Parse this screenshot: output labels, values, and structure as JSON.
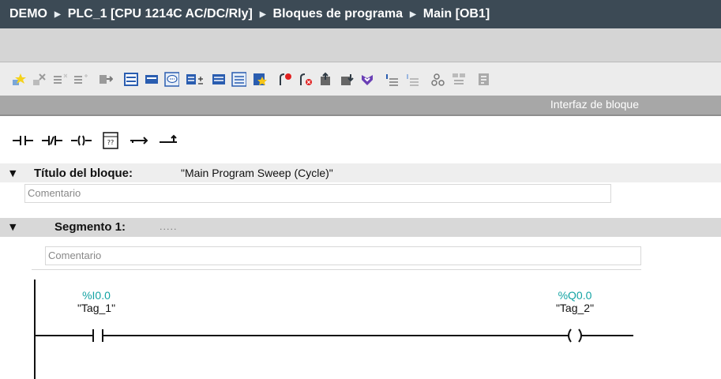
{
  "breadcrumb": {
    "items": [
      "DEMO",
      "PLC_1 [CPU 1214C AC/DC/Rly]",
      "Bloques de programa",
      "Main [OB1]"
    ]
  },
  "toolbar": {
    "icons": [
      "insert-network-icon",
      "delete-network-icon",
      "insert-row-icon",
      "add-row-icon",
      "go-to-icon",
      "absolute-operands-icon",
      "display-favorites-icon",
      "comments-toggle-icon",
      "network-comments-icon",
      "expand-all-icon",
      "collapse-all-icon",
      "zoom-icon",
      "favorites-icon",
      "monitoring-on-icon",
      "monitoring-off-icon",
      "upload-icon",
      "download-icon",
      "compile-icon",
      "indent-left-icon",
      "indent-right-icon",
      "breakpoint-icon",
      "compare-icon",
      "open-block-icon"
    ]
  },
  "interface_label": "Interfaz de bloque",
  "ladder_toolbar": {
    "icons": [
      "no-contact-icon",
      "nc-contact-icon",
      "coil-icon",
      "empty-box-icon",
      "open-branch-icon",
      "close-branch-icon"
    ]
  },
  "block_title": {
    "label": "Título del bloque:",
    "value": "\"Main Program Sweep (Cycle)\"",
    "comment_placeholder": "Comentario"
  },
  "segment": {
    "label": "Segmento 1:",
    "title_placeholder": ".....",
    "comment_placeholder": "Comentario"
  },
  "network": {
    "contact": {
      "address": "%I0.0",
      "tag": "\"Tag_1\""
    },
    "coil": {
      "address": "%Q0.0",
      "tag": "\"Tag_2\""
    }
  }
}
